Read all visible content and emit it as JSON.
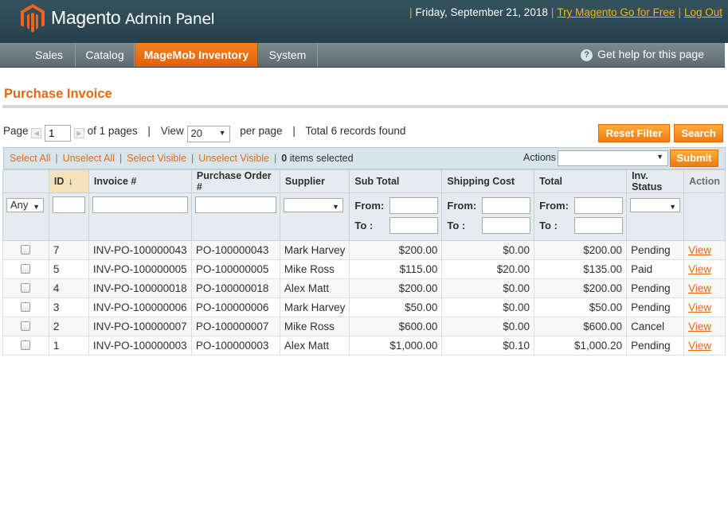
{
  "header": {
    "brand": "Magento",
    "brand_sub": "Admin Panel",
    "date": "Friday, September 21, 2018",
    "try_link": "Try Magento Go for Free",
    "logout_link": "Log Out",
    "colors": {
      "bar": "#2d4650",
      "link": "#f8b40f"
    }
  },
  "nav": {
    "items": [
      {
        "label": "Sales"
      },
      {
        "label": "Catalog"
      },
      {
        "label": "MageMob Inventory",
        "active": true
      },
      {
        "label": "System"
      }
    ],
    "help": "Get help for this page",
    "colors": {
      "active": "#e8680f"
    }
  },
  "page": {
    "title": "Purchase Invoice"
  },
  "pager": {
    "page_label": "Page",
    "page_value": "1",
    "of_pages": "of 1 pages",
    "view_label": "View",
    "per_page_value": "20",
    "per_page_label": "per page",
    "records": "Total 6 records found",
    "reset_filter": "Reset Filter",
    "search": "Search"
  },
  "massaction": {
    "select_all": "Select All",
    "unselect_all": "Unselect All",
    "select_visible": "Select Visible",
    "unselect_visible": "Unselect Visible",
    "selected_count": "0",
    "selected_text": "items selected",
    "actions_label": "Actions",
    "submit": "Submit"
  },
  "grid": {
    "columns": [
      "ID",
      "Invoice #",
      "Purchase Order #",
      "Supplier",
      "Sub Total",
      "Shipping Cost",
      "Total",
      "Inv. Status",
      "Action"
    ],
    "filter": {
      "any": "Any",
      "from": "From:",
      "to": "To :"
    },
    "rows": [
      {
        "id": "7",
        "invoice": "INV-PO-100000043",
        "po": "PO-100000043",
        "supplier": "Mark Harvey",
        "subtotal": "$200.00",
        "shipping": "$0.00",
        "total": "$200.00",
        "status": "Pending",
        "action": "View"
      },
      {
        "id": "5",
        "invoice": "INV-PO-100000005",
        "po": "PO-100000005",
        "supplier": "Mike Ross",
        "subtotal": "$115.00",
        "shipping": "$20.00",
        "total": "$135.00",
        "status": "Paid",
        "action": "View"
      },
      {
        "id": "4",
        "invoice": "INV-PO-100000018",
        "po": "PO-100000018",
        "supplier": "Alex Matt",
        "subtotal": "$200.00",
        "shipping": "$0.00",
        "total": "$200.00",
        "status": "Pending",
        "action": "View"
      },
      {
        "id": "3",
        "invoice": "INV-PO-100000006",
        "po": "PO-100000006",
        "supplier": "Mark Harvey",
        "subtotal": "$50.00",
        "shipping": "$0.00",
        "total": "$50.00",
        "status": "Pending",
        "action": "View"
      },
      {
        "id": "2",
        "invoice": "INV-PO-100000007",
        "po": "PO-100000007",
        "supplier": "Mike Ross",
        "subtotal": "$600.00",
        "shipping": "$0.00",
        "total": "$600.00",
        "status": "Cancel",
        "action": "View"
      },
      {
        "id": "1",
        "invoice": "INV-PO-100000003",
        "po": "PO-100000003",
        "supplier": "Alex Matt",
        "subtotal": "$1,000.00",
        "shipping": "$0.10",
        "total": "$1,000.20",
        "status": "Pending",
        "action": "View"
      }
    ]
  }
}
